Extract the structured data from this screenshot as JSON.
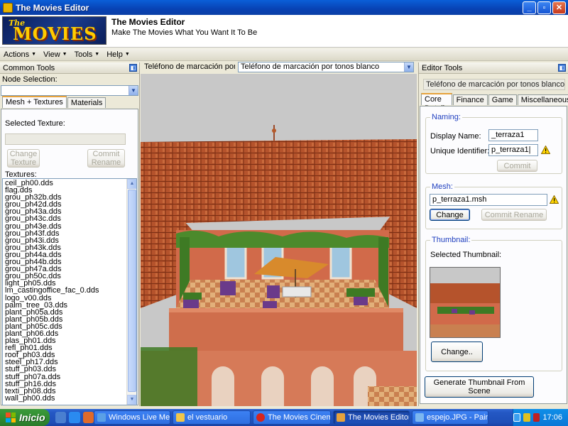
{
  "window": {
    "title": "The Movies Editor",
    "buttons": [
      "_",
      "▫",
      "✕"
    ]
  },
  "banner": {
    "logo_the": "The",
    "logo_movies": "MOVIES",
    "title": "The Movies Editor",
    "subtitle": "Make The Movies What You Want It To Be"
  },
  "menu": [
    {
      "label": "Actions"
    },
    {
      "label": "View"
    },
    {
      "label": "Tools"
    },
    {
      "label": "Help"
    }
  ],
  "left_panel": {
    "header": "Common Tools",
    "node_selection_label": "Node Selection:",
    "node_selection_value": "",
    "tabs": [
      "Mesh + Textures",
      "Materials"
    ],
    "selected_texture_label": "Selected Texture:",
    "selected_texture_value": "",
    "change_texture_button": "Change\nTexture",
    "commit_rename_button": "Commit\nRename",
    "textures_label": "Textures:",
    "textures": [
      "ceil_ph00.dds",
      "flag.dds",
      "grou_ph32b.dds",
      "grou_ph42d.dds",
      "grou_ph43a.dds",
      "grou_ph43c.dds",
      "grou_ph43e.dds",
      "grou_ph43f.dds",
      "grou_ph43i.dds",
      "grou_ph43k.dds",
      "grou_ph44a.dds",
      "grou_ph44b.dds",
      "grou_ph47a.dds",
      "grou_ph50c.dds",
      "light_ph05.dds",
      "lm_castingoffice_fac_0.dds",
      "logo_v00.dds",
      "palm_tree_03.dds",
      "plant_ph05a.dds",
      "plant_ph05b.dds",
      "plant_ph05c.dds",
      "plant_ph06.dds",
      "plas_ph01.dds",
      "refl_ph01.dds",
      "roof_ph03.dds",
      "steel_ph17.dds",
      "stuff_ph03.dds",
      "stuff_ph07a.dds",
      "stuff_ph16.dds",
      "texti_ph08.dds",
      "wall_ph00.dds"
    ]
  },
  "center": {
    "label_left": "Teléfono de marcación por tonos blanco",
    "dropdown_value": "Teléfono de marcación por tonos blanco"
  },
  "right_panel": {
    "header": "Editor Tools",
    "object_name": "Teléfono de marcación por tonos blanco",
    "tabs": [
      "Core Details",
      "Finance",
      "Game",
      "Miscellaneous"
    ],
    "naming": {
      "title": "Naming:",
      "display_name_label": "Display Name:",
      "display_name_value": "_terraza1",
      "unique_id_label": "Unique Identifier:",
      "unique_id_value": "p_terraza1|",
      "commit_button": "Commit"
    },
    "mesh": {
      "title": "Mesh:",
      "value": "p_terraza1.msh",
      "change_button": "Change",
      "commit_rename_button": "Commit Rename"
    },
    "thumbnail": {
      "title": "Thumbnail:",
      "selected_label": "Selected Thumbnail:",
      "change_button": "Change.."
    },
    "generate_button": "Generate Thumbnail  From Scene"
  },
  "taskbar": {
    "start": "Inicio",
    "tasks": [
      {
        "label": "Windows Live Me...",
        "color": "#5aa0e6",
        "active": false
      },
      {
        "label": "el vestuario",
        "color": "#f0c64a",
        "active": false
      },
      {
        "label": "The Movies Cinem...",
        "color": "#d8261c",
        "active": false
      },
      {
        "label": "The Movies Editor",
        "color": "#e6a23c",
        "active": true
      },
      {
        "label": "espejo.JPG - Paint",
        "color": "#7cb7f0",
        "active": false
      }
    ],
    "clock": "17:06"
  },
  "colors": {
    "titlebar": "#0842b4",
    "taskbar": "#245edb",
    "start": "#3c9a3c",
    "group_title": "#1f3fbf",
    "tab_highlight": "#e6a23c"
  }
}
